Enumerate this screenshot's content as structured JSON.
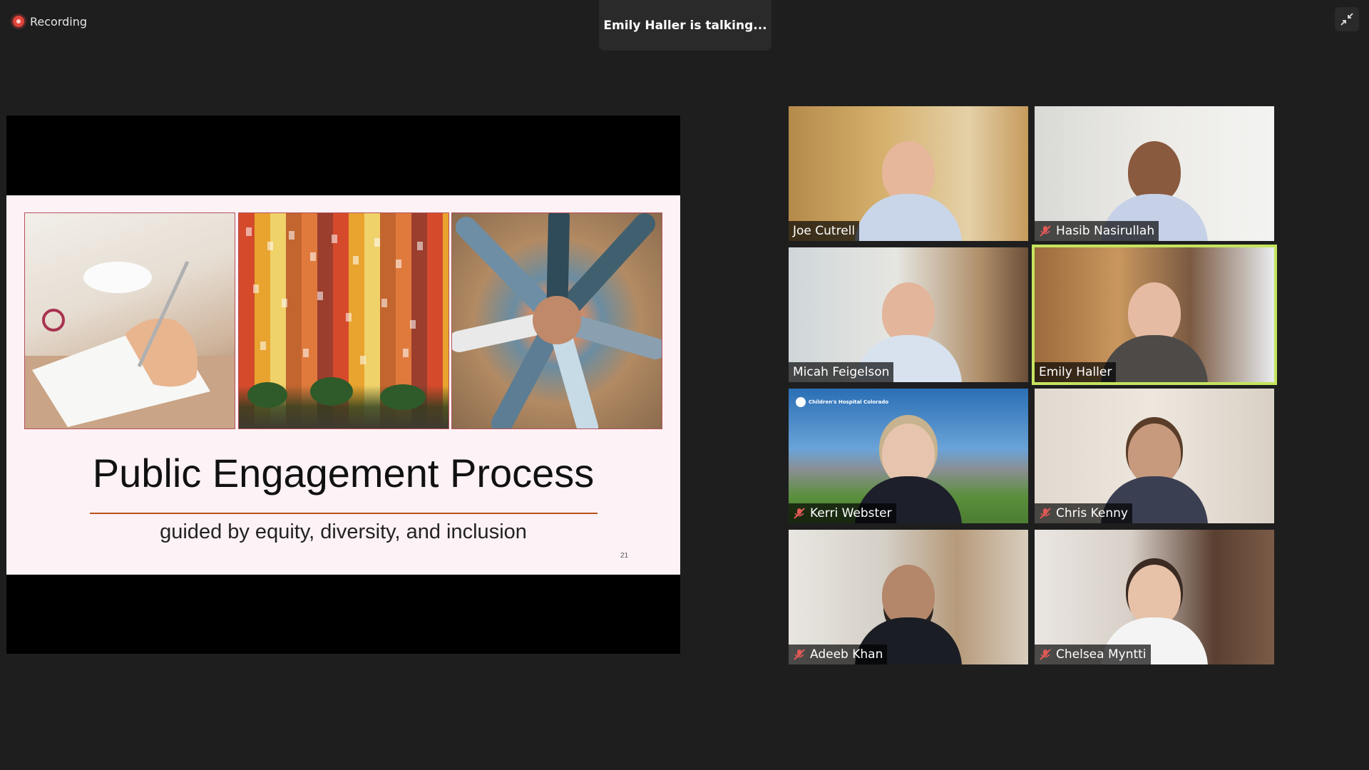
{
  "recording": {
    "label": "Recording"
  },
  "active_speaker": {
    "text": "Emily Haller is talking..."
  },
  "slide": {
    "title": "Public Engagement Process",
    "subtitle": "guided by equity, diversity, and inclusion",
    "page_number": "21"
  },
  "participants": [
    {
      "name": "Joe Cutrell",
      "muted": false
    },
    {
      "name": "Hasib Nasirullah",
      "muted": true
    },
    {
      "name": "Micah Feigelson",
      "muted": false
    },
    {
      "name": "Emily Haller",
      "muted": false,
      "active": true
    },
    {
      "name": "Kerri Webster",
      "muted": true
    },
    {
      "name": "Chris Kenny",
      "muted": true
    },
    {
      "name": "Adeeb Khan",
      "muted": true
    },
    {
      "name": "Chelsea Myntti",
      "muted": true
    }
  ],
  "kerri_background_logo": "Children's Hospital Colorado",
  "colors": {
    "background": "#1e1e1e",
    "recording_red": "#e0453a",
    "active_speaker_border": "#c5e55e",
    "muted_icon": "#e05a57",
    "slide_rule": "#b8521a"
  }
}
